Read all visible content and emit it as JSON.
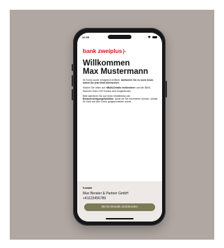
{
  "status_bar": {
    "time": "10:05",
    "signal": "..."
  },
  "brand": {
    "name_part1": "bank ",
    "name_part2": "zweiplus",
    "mark": "}-"
  },
  "header": {
    "title_line1": "Willkommen",
    "title_line2": "Max Mustermann"
  },
  "body": {
    "p1_normal": "Ihr Konto wurde erfolgreich eröffnet.",
    "p1_bold": "Aktivieren Sie es noch heute, indem Sie jetzt Geld überweisen.",
    "p2_pre": "Klicken Sie unten auf ",
    "p2_bold": "«IBAN-Details einblenden»",
    "p2_post": " und die IBAN-Nummer Ihres CHF-Kontos wird eingeblendet.",
    "p3_pre": "Bitte aktivieren Sie auf Ihrem Mobiltelefon die ",
    "p3_bold": "Benachrichtigungsfunktion",
    "p3_post": ", damit wir Sie informieren können, sobald Ihr Geld auf dem Konto gutgeschrieben wurde."
  },
  "contact": {
    "label": "Kontakt",
    "name": "Max Berater & Partner GmbH",
    "phone": "+41123456789"
  },
  "cta": {
    "label": "IBAN-Details einblenden"
  },
  "colors": {
    "brand_red": "#d21b1f",
    "button": "#7b7a57",
    "backdrop": "#b0a7a2"
  }
}
